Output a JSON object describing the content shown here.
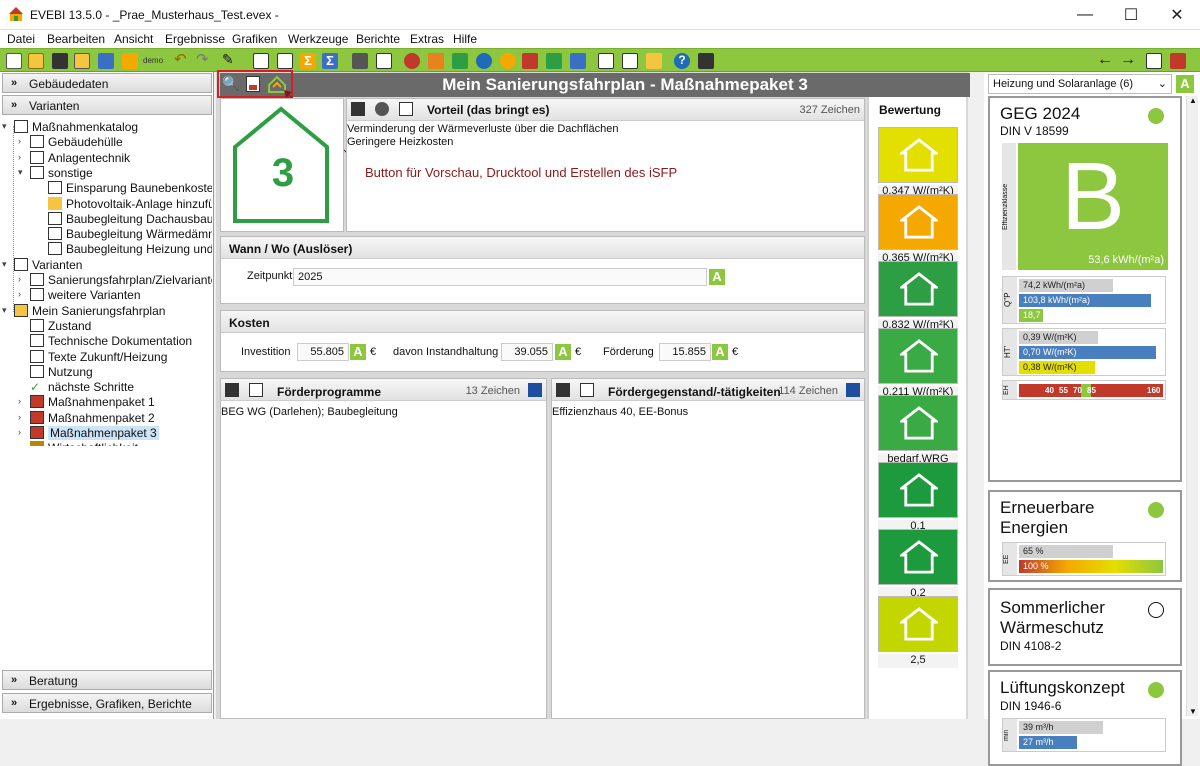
{
  "window": {
    "title": "EVEBI 13.5.0 - _Prae_Musterhaus_Test.evex -",
    "minimize": "—",
    "maximize": "☐",
    "close": "✕"
  },
  "menu": [
    "Datei",
    "Bearbeiten",
    "Ansicht",
    "Ergebnisse",
    "Grafiken",
    "Werkzeuge",
    "Berichte",
    "Extras",
    "Hilfe"
  ],
  "toolbar": {
    "demo_label": "demo",
    "back": "←",
    "forward": "→"
  },
  "left": {
    "sections": {
      "gebaeudedaten": "Gebäudedaten",
      "varianten": "Varianten",
      "beratung": "Beratung",
      "ergebnisse": "Ergebnisse, Grafiken, Berichte"
    },
    "tree": [
      {
        "label": "Maßnahmenkatalog"
      },
      {
        "label": "Gebäudehülle"
      },
      {
        "label": "Anlagentechnik"
      },
      {
        "label": "sonstige"
      },
      {
        "label": "Einsparung Baunebenkosten"
      },
      {
        "label": "Photovoltaik-Anlage hinzufügen"
      },
      {
        "label": "Baubegleitung Dachausbau"
      },
      {
        "label": "Baubegleitung Wärmedämmung"
      },
      {
        "label": "Baubegleitung Heizung und Solar"
      },
      {
        "label": "Varianten"
      },
      {
        "label": "Sanierungsfahrplan/Zielvariante"
      },
      {
        "label": "weitere Varianten"
      },
      {
        "label": "Mein Sanierungsfahrplan"
      },
      {
        "label": "Zustand"
      },
      {
        "label": "Technische Dokumentation"
      },
      {
        "label": "Texte Zukunft/Heizung"
      },
      {
        "label": "Nutzung"
      },
      {
        "label": "nächste Schritte"
      },
      {
        "label": "Maßnahmenpaket 1"
      },
      {
        "label": "Maßnahmenpaket 2"
      },
      {
        "label": "Maßnahmenpaket 3"
      },
      {
        "label": "Wirtschaftlichkeit"
      }
    ]
  },
  "center": {
    "title": "Mein Sanierungsfahrplan - Maßnahmepaket 3",
    "package_number": "3",
    "annotation": "Button für Vorschau, Drucktool und Erstellen des iSFP",
    "vorteil": {
      "heading": "Vorteil (das bringt es)",
      "count": "327 Zeichen",
      "lines": [
        "Verminderung der Wärmeverluste über die Dachflächen",
        "Geringere Heizkosten"
      ]
    },
    "wann": {
      "heading": "Wann / Wo (Auslöser)",
      "label": "Zeitpunkt",
      "value": "2025",
      "badge": "A"
    },
    "kosten": {
      "heading": "Kosten",
      "investition_label": "Investition",
      "investition_value": "55.805",
      "instandhaltung_label": "davon Instandhaltung",
      "instandhaltung_value": "39.055",
      "foerderung_label": "Förderung",
      "foerderung_value": "15.855",
      "currency": "€",
      "badge": "A"
    },
    "foerderprogramme": {
      "heading": "Förderprogramme",
      "count": "13 Zeichen",
      "text": "BEG WG (Darlehen); Baubegleitung"
    },
    "foerdergegenstand": {
      "heading": "Fördergegenstand/-tätigkeiten",
      "count": "114 Zeichen",
      "text": "Effizienzhaus 40, EE-Bonus"
    }
  },
  "bewertung": {
    "heading": "Bewertung",
    "items": [
      {
        "value": "0,347 W/(m²K)",
        "color": "#e3df00"
      },
      {
        "value": "0,365 W/(m²K)",
        "color": "#f5a800"
      },
      {
        "value": "0,832 W/(m²K)",
        "color": "#2e9e45"
      },
      {
        "value": "0,211 W/(m²K)",
        "color": "#3aaa45"
      },
      {
        "value": "bedarf.WRG",
        "color": "#3aaa45"
      },
      {
        "value": "0,1",
        "color": "#1e9a3e"
      },
      {
        "value": "0,2",
        "color": "#1e9a3e"
      },
      {
        "value": "2,5",
        "color": "#c4d600"
      }
    ]
  },
  "right": {
    "dropdown": "Heizung und Solaranlage (6)",
    "badge": "A",
    "geg": {
      "title": "GEG 2024",
      "sub": "DIN V 18599",
      "class": "B",
      "value": "53,6 kWh/(m²a)",
      "side_label": "Effizienzklasse",
      "qp_label": "Q''P",
      "qp_bars": [
        {
          "label": "74,2 kWh/(m²a)",
          "color": "#d0d0d0",
          "frac": 0.65
        },
        {
          "label": "103,8 kWh/(m²a)",
          "color": "#4a7fbf",
          "frac": 0.92
        },
        {
          "label": "18,7 kWh/(m²a)",
          "color": "#8dc63f",
          "frac": 0.17
        }
      ],
      "ht_label": "HT'",
      "ht_bars": [
        {
          "label": "0,39 W/(m²K)",
          "color": "#d0d0d0",
          "frac": 0.55
        },
        {
          "label": "0,70 W/(m²K)",
          "color": "#4a7fbf",
          "frac": 0.95
        },
        {
          "label": "0,38 W/(m²K)",
          "color": "#e3df00",
          "frac": 0.53
        }
      ],
      "eh_label": "EH",
      "eh_ticks": [
        "40",
        "55",
        "70",
        "85",
        "160"
      ]
    },
    "ee": {
      "title1": "Erneuerbare",
      "title2": "Energien",
      "label": "EE",
      "bars": [
        {
          "label": "65 %",
          "color": "#d0d0d0",
          "frac": 0.65
        },
        {
          "label": "100 %",
          "color": "#c0392b",
          "frac": 1.0
        }
      ]
    },
    "sommer": {
      "title1": "Sommerlicher",
      "title2": "Wärmeschutz",
      "sub": "DIN 4108-2"
    },
    "lueftung": {
      "title": "Lüftungskonzept",
      "sub": "DIN 1946-6",
      "label": "min",
      "bars": [
        {
          "label": "39 m³/h",
          "color": "#d0d0d0",
          "frac": 0.58
        },
        {
          "label": "27 m³/h",
          "color": "#4a7fbf",
          "frac": 0.4
        }
      ]
    }
  }
}
